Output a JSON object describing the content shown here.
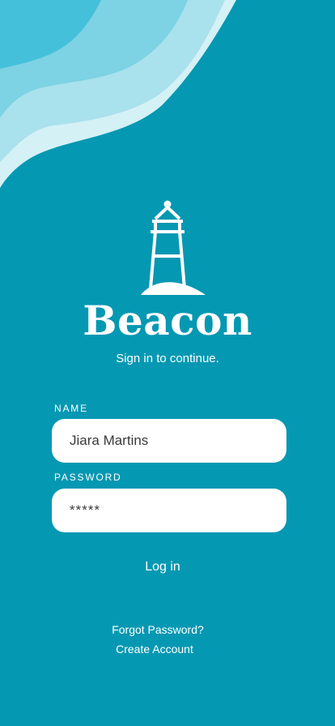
{
  "app": {
    "title": "Beacon",
    "subtitle": "Sign in to continue."
  },
  "form": {
    "name_label": "NAME",
    "name_value": "Jiara Martins",
    "password_label": "PASSWORD",
    "password_value": "*****",
    "login_label": "Log in"
  },
  "links": {
    "forgot_password": "Forgot Password?",
    "create_account": "Create Account"
  },
  "colors": {
    "background": "#0598b2",
    "wave_1": "#45c0da",
    "wave_2": "#7dd2e4",
    "wave_3": "#a9e1ec",
    "wave_4": "#d4f1f6",
    "text": "#ffffff",
    "field_background": "#ffffff"
  },
  "icons": {
    "logo": "lighthouse-icon"
  }
}
